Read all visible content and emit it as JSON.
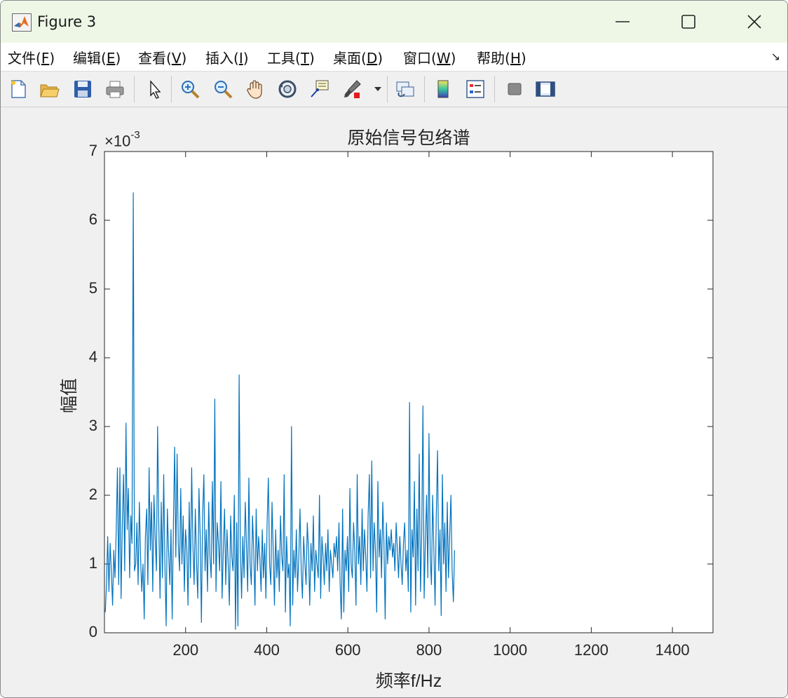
{
  "window": {
    "title": "Figure 3",
    "controls": [
      "minimize",
      "maximize",
      "close"
    ]
  },
  "menu": {
    "items": [
      {
        "label": "文件(F)",
        "text": "文件(",
        "key": "F"
      },
      {
        "label": "编辑(E)",
        "text": "编辑(",
        "key": "E"
      },
      {
        "label": "查看(V)",
        "text": "查看(",
        "key": "V"
      },
      {
        "label": "插入(I)",
        "text": "插入(",
        "key": "I"
      },
      {
        "label": "工具(T)",
        "text": "工具(",
        "key": "T"
      },
      {
        "label": "桌面(D)",
        "text": "桌面(",
        "key": "D"
      },
      {
        "label": "窗口(W)",
        "text": "窗口(",
        "key": "W"
      },
      {
        "label": "帮助(H)",
        "text": "帮助(",
        "key": "H"
      }
    ],
    "corner_icon": "dock-arrow-icon"
  },
  "toolbar": {
    "icons": [
      "new-figure-icon",
      "open-file-icon",
      "save-icon",
      "print-icon",
      "edit-plot-arrow-icon",
      "zoom-in-icon",
      "zoom-out-icon",
      "pan-hand-icon",
      "rotate-3d-icon",
      "data-cursor-icon",
      "brush-icon",
      "link-plot-icon",
      "colorbar-icon",
      "legend-icon",
      "hide-plot-tools-icon",
      "show-plot-tools-icon"
    ]
  },
  "chart_data": {
    "type": "line",
    "title": "原始信号包络谱",
    "xlabel": "频率f/Hz",
    "ylabel": "幅值",
    "y_exponent_label": "×10",
    "y_exponent": "-3",
    "xlim": [
      0,
      1500
    ],
    "ylim": [
      0,
      7
    ],
    "xticks": [
      "200",
      "400",
      "600",
      "800",
      "1000",
      "1200",
      "1400"
    ],
    "yticks": [
      "0",
      "1",
      "2",
      "3",
      "4",
      "5",
      "6",
      "7"
    ],
    "grid": false,
    "line_color": "#0072bd",
    "series": [
      {
        "x_start": 2,
        "x_step": 3,
        "values": [
          0.3,
          0.7,
          1.4,
          0.6,
          1.3,
          0.9,
          0.4,
          1.2,
          0.8,
          1.5,
          2.4,
          0.7,
          2.4,
          0.5,
          1.6,
          2.3,
          0.9,
          3.05,
          1.5,
          2.1,
          0.8,
          1.7,
          1.3,
          6.4,
          0.9,
          1.0,
          1.6,
          0.7,
          1.9,
          1.1,
          0.6,
          1.0,
          0.2,
          1.4,
          1.8,
          0.7,
          2.4,
          1.2,
          1.9,
          0.6,
          2.0,
          1.4,
          0.9,
          3.0,
          1.6,
          0.5,
          1.9,
          0.8,
          2.3,
          1.0,
          0.1,
          1.8,
          1.2,
          0.7,
          1.5,
          0.2,
          1.6,
          2.7,
          1.1,
          2.6,
          1.3,
          0.9,
          2.1,
          1.0,
          1.7,
          0.6,
          1.5,
          1.2,
          0.4,
          1.9,
          0.8,
          2.4,
          1.3,
          0.7,
          1.8,
          1.0,
          0.5,
          2.1,
          1.4,
          0.15,
          1.7,
          2.3,
          0.9,
          1.5,
          0.6,
          1.9,
          1.1,
          0.8,
          2.2,
          1.0,
          3.4,
          0.6,
          1.6,
          1.3,
          0.9,
          2.2,
          0.5,
          1.2,
          1.8,
          0.7,
          1.5,
          1.0,
          0.4,
          1.7,
          1.1,
          0.9,
          2.0,
          0.05,
          1.6,
          0.1,
          3.75,
          1.2,
          0.5,
          1.4,
          0.8,
          1.9,
          1.3,
          0.6,
          2.25,
          1.0,
          0.7,
          1.7,
          1.2,
          0.4,
          1.8,
          0.9,
          1.4,
          1.1,
          0.6,
          1.5,
          0.8,
          1.3,
          0.5,
          1.6,
          2.25,
          1.0,
          0.7,
          1.9,
          1.2,
          0.4,
          1.5,
          0.8,
          1.2,
          0.6,
          1.7,
          1.1,
          0.9,
          2.3,
          0.3,
          1.4,
          0.8,
          1.0,
          0.1,
          3.0,
          0.4,
          1.2,
          0.8,
          1.5,
          0.6,
          1.1,
          1.8,
          0.9,
          0.5,
          1.4,
          1.0,
          0.7,
          1.6,
          1.2,
          0.4,
          1.3,
          0.9,
          1.7,
          0.6,
          1.2,
          1.0,
          0.8,
          2.0,
          0.5,
          1.4,
          1.1,
          0.7,
          1.3,
          0.9,
          1.5,
          0.6,
          1.2,
          1.0,
          0.8,
          1.3,
          1.1,
          1.4,
          0.9,
          1.6,
          0.7,
          0.2,
          1.8,
          0.3,
          1.2,
          0.9,
          1.4,
          0.6,
          2.1,
          1.0,
          0.8,
          1.6,
          1.2,
          0.4,
          2.3,
          1.0,
          1.4,
          0.7,
          1.8,
          0.9,
          1.5,
          1.1,
          0.6,
          1.7,
          2.3,
          0.8,
          2.5,
          0.9,
          1.6,
          1.2,
          0.3,
          2.2,
          1.1,
          1.5,
          0.8,
          1.9,
          1.3,
          0.2,
          1.6,
          1.0,
          1.4,
          1.2,
          1.5,
          1.1,
          1.3,
          0.9,
          1.6,
          1.2,
          0.8,
          1.4,
          1.0,
          0.7,
          1.3,
          1.6,
          0.9,
          1.2,
          0.6,
          3.35,
          0.3,
          1.5,
          1.1,
          2.2,
          0.4,
          1.8,
          0.9,
          2.6,
          0.6,
          1.4,
          3.3,
          0.5,
          1.3,
          2.0,
          0.8,
          2.9,
          1.1,
          0.7,
          2.0,
          1.2,
          0.4,
          1.7,
          2.65,
          0.9,
          1.5,
          0.25,
          2.3,
          1.0,
          1.6,
          0.6,
          1.9,
          0.8,
          1.4,
          2.0,
          0.9,
          0.45,
          1.2
        ]
      }
    ]
  }
}
